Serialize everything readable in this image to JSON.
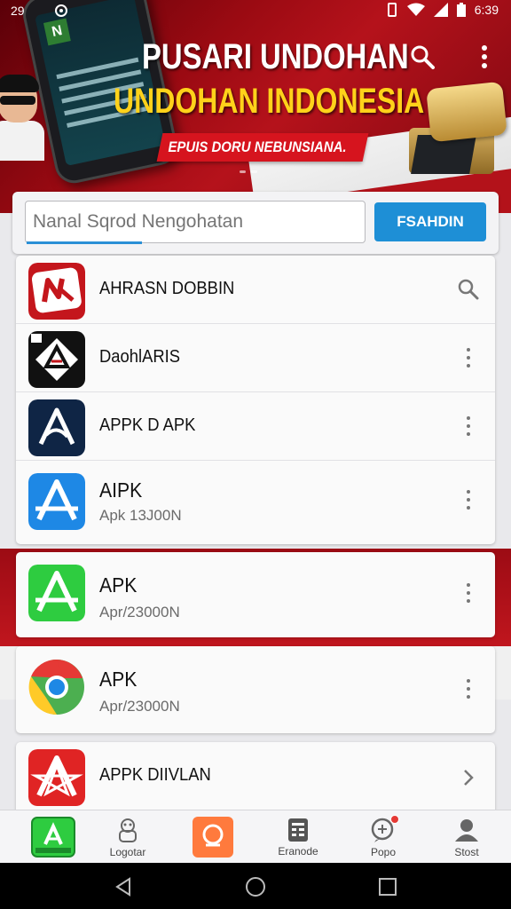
{
  "status_bar": {
    "left_indicator": "29",
    "time": "6:39"
  },
  "hero": {
    "title": "PUSARI UNDOHAN",
    "subtitle": "UNDOHAN INDONESIA",
    "tagline": "EPUIS DORU NEBUNSIANA.",
    "phone_logo": "N",
    "search_icon": "search-icon",
    "menu_icon": "more-vertical-icon"
  },
  "search": {
    "placeholder": "Nanal Sqrod Nengohatan",
    "button_label": "FSAHDIN"
  },
  "apps": [
    {
      "name": "AHRASN DOBBIN",
      "version": "",
      "action": "search-icon",
      "icon_color": "#c4161c"
    },
    {
      "name": "DaohlARIS",
      "version": "",
      "action": "more-vertical-icon",
      "icon_color": "#111111"
    },
    {
      "name": "APPK D APK",
      "version": "",
      "action": "more-vertical-icon",
      "icon_color": "#0f2545"
    },
    {
      "name": "AIPK",
      "version": "Apk 13J00N",
      "action": "more-vertical-icon",
      "icon_color": "#1e88e5"
    },
    {
      "name": "APK",
      "version": "Apr/23000N",
      "action": "more-vertical-icon",
      "icon_color": "#2ecc40"
    },
    {
      "name": "APK",
      "version": "Apr/23000N",
      "action": "more-vertical-icon",
      "icon_color": "#4caf50"
    },
    {
      "name": "APPK DIIVLAN",
      "version": "",
      "action": "chevron-right-icon",
      "icon_color": "#e02424"
    }
  ],
  "bottom_nav": [
    {
      "label": "",
      "icon": "apk-home-icon"
    },
    {
      "label": "Logotar",
      "icon": "robot-icon"
    },
    {
      "label": "",
      "icon": "orange-app-icon"
    },
    {
      "label": "Eranode",
      "icon": "document-icon"
    },
    {
      "label": "Popo",
      "icon": "chat-icon"
    },
    {
      "label": "Stost",
      "icon": "user-icon"
    }
  ],
  "colors": {
    "accent": "#1e8fd6",
    "hero_red": "#b5121b",
    "hero_yellow": "#ffd21a"
  }
}
